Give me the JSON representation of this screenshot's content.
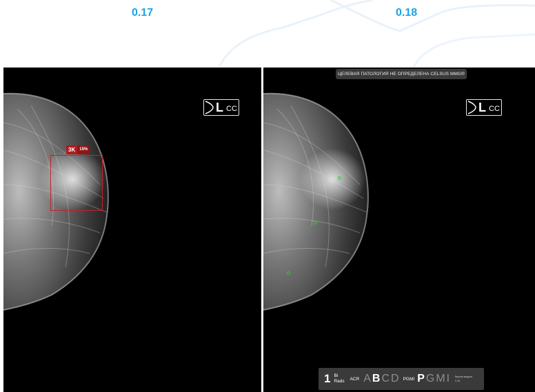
{
  "versions": {
    "left": "0.17",
    "right": "0.18"
  },
  "left_panel": {
    "view": {
      "laterality": "L",
      "projection": "CC"
    },
    "detection": {
      "label": "3K",
      "confidence": "15%",
      "color": "#c42226"
    }
  },
  "right_panel": {
    "view": {
      "laterality": "L",
      "projection": "CC"
    },
    "banner": "ЦЕЛЕВАЯ ПАТОЛОГИЯ НЕ ОПРЕДЕЛЕНА   CELSUS MMG®",
    "marker_color": "#2bd02b",
    "scores": {
      "birads_value": "1",
      "birads_label_line1": "Bi",
      "birads_label_line2": "Rads",
      "acr_label": "ACR",
      "acr_letters": [
        "A",
        "B",
        "C",
        "D"
      ],
      "acr_selected": "B",
      "pgmi_label": "PGMI",
      "pgmi_letters": [
        "P",
        "G",
        "M",
        "I"
      ],
      "pgmi_selected": "P",
      "model_info_line1": "Версия модели",
      "model_info_line2": "0.18"
    }
  },
  "colors": {
    "accent": "#1aa3e8",
    "panel_bg": "#000000",
    "bar_bg": "#3a3a3a"
  }
}
